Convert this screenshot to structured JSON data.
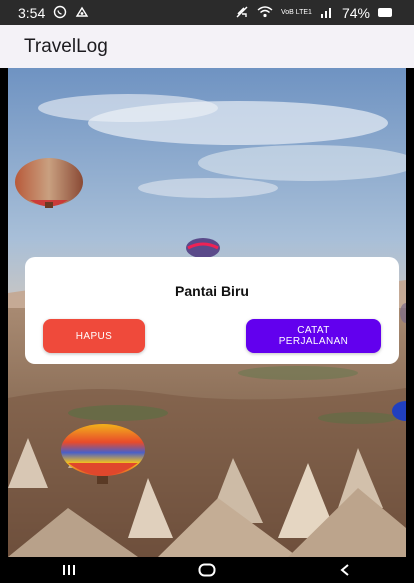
{
  "status_bar": {
    "time": "3:54",
    "network_label": "VoB LTE1",
    "battery_percent": "74%",
    "icons": [
      "whatsapp-icon",
      "sync-icon",
      "mute-icon",
      "wifi-icon",
      "signal-icon",
      "battery-icon"
    ]
  },
  "app_bar": {
    "title": "TravelLog"
  },
  "card": {
    "title": "Pantai Biru",
    "delete_label": "HAPUS",
    "record_label": "CATAT PERJALANAN"
  },
  "colors": {
    "delete_button": "#ef4a3b",
    "record_button": "#6200ee",
    "app_bar_bg": "#f4f2f7",
    "status_bar_bg": "#2b2b2b"
  },
  "nav_bar": {
    "icons": [
      "recent-apps-icon",
      "home-icon",
      "back-icon"
    ]
  }
}
